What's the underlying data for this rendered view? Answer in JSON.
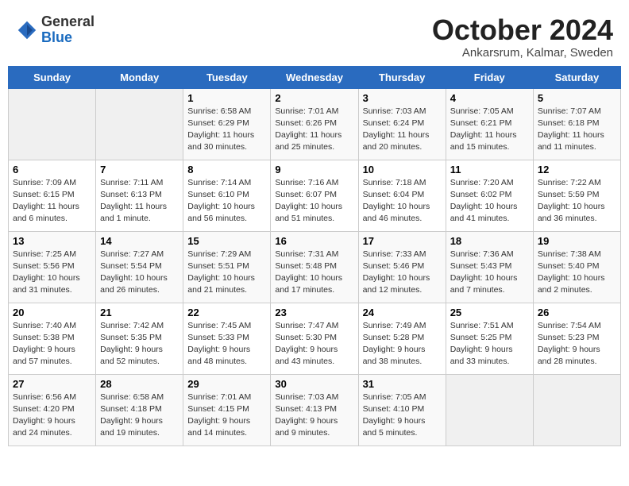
{
  "header": {
    "logo_general": "General",
    "logo_blue": "Blue",
    "month_title": "October 2024",
    "subtitle": "Ankarsrum, Kalmar, Sweden"
  },
  "days_of_week": [
    "Sunday",
    "Monday",
    "Tuesday",
    "Wednesday",
    "Thursday",
    "Friday",
    "Saturday"
  ],
  "weeks": [
    [
      {
        "day": "",
        "detail": ""
      },
      {
        "day": "",
        "detail": ""
      },
      {
        "day": "1",
        "detail": "Sunrise: 6:58 AM\nSunset: 6:29 PM\nDaylight: 11 hours\nand 30 minutes."
      },
      {
        "day": "2",
        "detail": "Sunrise: 7:01 AM\nSunset: 6:26 PM\nDaylight: 11 hours\nand 25 minutes."
      },
      {
        "day": "3",
        "detail": "Sunrise: 7:03 AM\nSunset: 6:24 PM\nDaylight: 11 hours\nand 20 minutes."
      },
      {
        "day": "4",
        "detail": "Sunrise: 7:05 AM\nSunset: 6:21 PM\nDaylight: 11 hours\nand 15 minutes."
      },
      {
        "day": "5",
        "detail": "Sunrise: 7:07 AM\nSunset: 6:18 PM\nDaylight: 11 hours\nand 11 minutes."
      }
    ],
    [
      {
        "day": "6",
        "detail": "Sunrise: 7:09 AM\nSunset: 6:15 PM\nDaylight: 11 hours\nand 6 minutes."
      },
      {
        "day": "7",
        "detail": "Sunrise: 7:11 AM\nSunset: 6:13 PM\nDaylight: 11 hours\nand 1 minute."
      },
      {
        "day": "8",
        "detail": "Sunrise: 7:14 AM\nSunset: 6:10 PM\nDaylight: 10 hours\nand 56 minutes."
      },
      {
        "day": "9",
        "detail": "Sunrise: 7:16 AM\nSunset: 6:07 PM\nDaylight: 10 hours\nand 51 minutes."
      },
      {
        "day": "10",
        "detail": "Sunrise: 7:18 AM\nSunset: 6:04 PM\nDaylight: 10 hours\nand 46 minutes."
      },
      {
        "day": "11",
        "detail": "Sunrise: 7:20 AM\nSunset: 6:02 PM\nDaylight: 10 hours\nand 41 minutes."
      },
      {
        "day": "12",
        "detail": "Sunrise: 7:22 AM\nSunset: 5:59 PM\nDaylight: 10 hours\nand 36 minutes."
      }
    ],
    [
      {
        "day": "13",
        "detail": "Sunrise: 7:25 AM\nSunset: 5:56 PM\nDaylight: 10 hours\nand 31 minutes."
      },
      {
        "day": "14",
        "detail": "Sunrise: 7:27 AM\nSunset: 5:54 PM\nDaylight: 10 hours\nand 26 minutes."
      },
      {
        "day": "15",
        "detail": "Sunrise: 7:29 AM\nSunset: 5:51 PM\nDaylight: 10 hours\nand 21 minutes."
      },
      {
        "day": "16",
        "detail": "Sunrise: 7:31 AM\nSunset: 5:48 PM\nDaylight: 10 hours\nand 17 minutes."
      },
      {
        "day": "17",
        "detail": "Sunrise: 7:33 AM\nSunset: 5:46 PM\nDaylight: 10 hours\nand 12 minutes."
      },
      {
        "day": "18",
        "detail": "Sunrise: 7:36 AM\nSunset: 5:43 PM\nDaylight: 10 hours\nand 7 minutes."
      },
      {
        "day": "19",
        "detail": "Sunrise: 7:38 AM\nSunset: 5:40 PM\nDaylight: 10 hours\nand 2 minutes."
      }
    ],
    [
      {
        "day": "20",
        "detail": "Sunrise: 7:40 AM\nSunset: 5:38 PM\nDaylight: 9 hours\nand 57 minutes."
      },
      {
        "day": "21",
        "detail": "Sunrise: 7:42 AM\nSunset: 5:35 PM\nDaylight: 9 hours\nand 52 minutes."
      },
      {
        "day": "22",
        "detail": "Sunrise: 7:45 AM\nSunset: 5:33 PM\nDaylight: 9 hours\nand 48 minutes."
      },
      {
        "day": "23",
        "detail": "Sunrise: 7:47 AM\nSunset: 5:30 PM\nDaylight: 9 hours\nand 43 minutes."
      },
      {
        "day": "24",
        "detail": "Sunrise: 7:49 AM\nSunset: 5:28 PM\nDaylight: 9 hours\nand 38 minutes."
      },
      {
        "day": "25",
        "detail": "Sunrise: 7:51 AM\nSunset: 5:25 PM\nDaylight: 9 hours\nand 33 minutes."
      },
      {
        "day": "26",
        "detail": "Sunrise: 7:54 AM\nSunset: 5:23 PM\nDaylight: 9 hours\nand 28 minutes."
      }
    ],
    [
      {
        "day": "27",
        "detail": "Sunrise: 6:56 AM\nSunset: 4:20 PM\nDaylight: 9 hours\nand 24 minutes."
      },
      {
        "day": "28",
        "detail": "Sunrise: 6:58 AM\nSunset: 4:18 PM\nDaylight: 9 hours\nand 19 minutes."
      },
      {
        "day": "29",
        "detail": "Sunrise: 7:01 AM\nSunset: 4:15 PM\nDaylight: 9 hours\nand 14 minutes."
      },
      {
        "day": "30",
        "detail": "Sunrise: 7:03 AM\nSunset: 4:13 PM\nDaylight: 9 hours\nand 9 minutes."
      },
      {
        "day": "31",
        "detail": "Sunrise: 7:05 AM\nSunset: 4:10 PM\nDaylight: 9 hours\nand 5 minutes."
      },
      {
        "day": "",
        "detail": ""
      },
      {
        "day": "",
        "detail": ""
      }
    ]
  ]
}
